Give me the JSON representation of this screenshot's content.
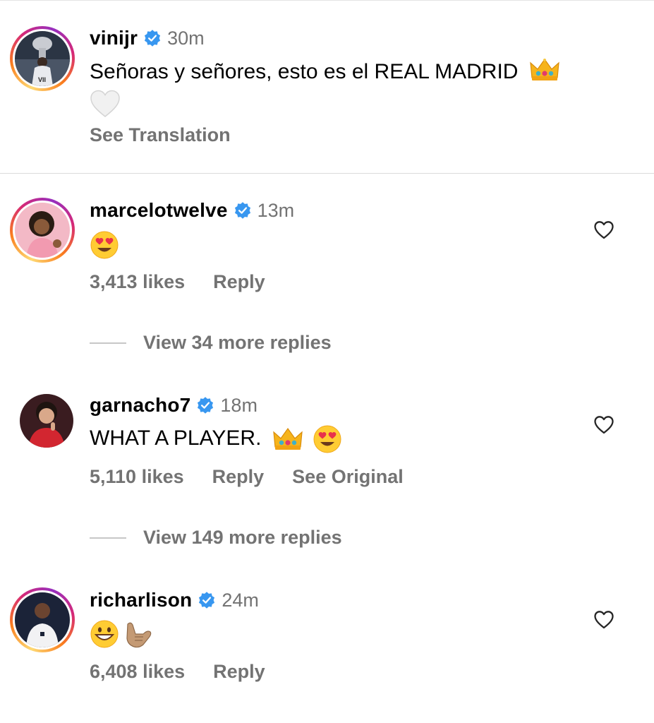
{
  "caption": {
    "username": "vinijr",
    "time": "30m",
    "text": "Señoras y señores, esto es el REAL MADRID",
    "see_translation": "See Translation"
  },
  "comments": [
    {
      "username": "marcelotwelve",
      "time": "13m",
      "text": "",
      "likes": "3,413 likes",
      "reply": "Reply",
      "view_more": "View 34 more replies"
    },
    {
      "username": "garnacho7",
      "time": "18m",
      "text": "WHAT A PLAYER.",
      "likes": "5,110 likes",
      "reply": "Reply",
      "see_original": "See Original",
      "view_more": "View 149 more replies"
    },
    {
      "username": "richarlison",
      "time": "24m",
      "text": "",
      "likes": "6,408 likes",
      "reply": "Reply"
    }
  ],
  "icons": {
    "verified": "verified-badge-icon",
    "heart": "heart-outline-icon",
    "crown": "crown-emoji",
    "white_heart": "white-heart-emoji",
    "heart_eyes": "heart-eyes-emoji",
    "grin": "grinning-face-emoji",
    "call_me": "call-me-hand-emoji"
  },
  "colors": {
    "verified_blue": "#3897f0",
    "secondary_text": "#737373",
    "divider": "#dbdbdb"
  }
}
